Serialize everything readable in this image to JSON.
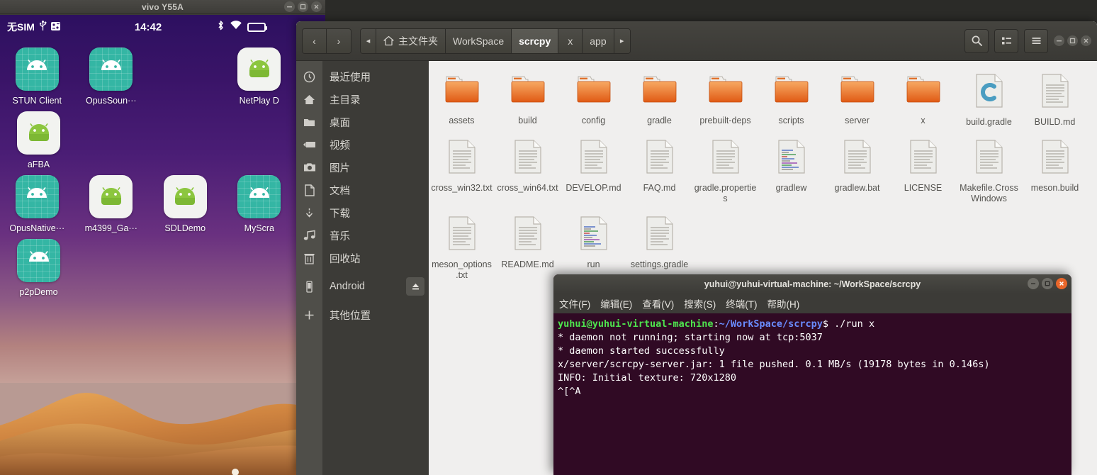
{
  "phone": {
    "window_title": "vivo Y55A",
    "window_controls": [
      "minimize",
      "maximize",
      "close"
    ],
    "status_bar": {
      "sim": "无SIM",
      "left_icons": [
        "usb-icon",
        "vpn-key-icon"
      ],
      "time": "14:42",
      "right_icons": [
        "bluetooth-icon",
        "wifi-icon",
        "battery-icon"
      ]
    },
    "apps": [
      {
        "label": "STUN Client",
        "icon": "android-robot-icon",
        "style": "teal"
      },
      {
        "label": "OpusSoun···",
        "icon": "android-robot-icon",
        "style": "teal"
      },
      {
        "label": "",
        "icon": "",
        "style": "empty"
      },
      {
        "label": "NetPlay D",
        "icon": "android-robot-icon",
        "style": "white"
      },
      {
        "label": "aFBA",
        "icon": "android-robot-icon",
        "style": "white"
      },
      {
        "label": "OpusNative···",
        "icon": "android-robot-icon",
        "style": "teal"
      },
      {
        "label": "m4399_Ga···",
        "icon": "android-robot-icon",
        "style": "white"
      },
      {
        "label": "SDLDemo",
        "icon": "android-robot-icon",
        "style": "white"
      },
      {
        "label": "MyScra",
        "icon": "android-robot-icon",
        "style": "teal"
      },
      {
        "label": "p2pDemo",
        "icon": "android-robot-icon",
        "style": "teal"
      }
    ]
  },
  "file_manager": {
    "nav": {
      "back": "‹",
      "forward": "›"
    },
    "breadcrumb_scroll_left": "◂",
    "breadcrumb_scroll_right": "▸",
    "breadcrumbs": [
      {
        "label": "主文件夹",
        "icon": "home-icon",
        "active": false
      },
      {
        "label": "WorkSpace",
        "icon": "",
        "active": false
      },
      {
        "label": "scrcpy",
        "icon": "",
        "active": true
      },
      {
        "label": "x",
        "icon": "",
        "active": false
      },
      {
        "label": "app",
        "icon": "",
        "active": false
      }
    ],
    "header_buttons": [
      "search-icon",
      "view-list-icon",
      "hamburger-menu-icon"
    ],
    "window_controls": [
      "minimize",
      "maximize",
      "close"
    ],
    "sidebar": [
      {
        "label": "最近使用",
        "icon": "clock-icon"
      },
      {
        "label": "主目录",
        "icon": "home-icon"
      },
      {
        "label": "桌面",
        "icon": "folder-icon"
      },
      {
        "label": "视频",
        "icon": "video-icon"
      },
      {
        "label": "图片",
        "icon": "camera-icon"
      },
      {
        "label": "文档",
        "icon": "document-icon"
      },
      {
        "label": "下载",
        "icon": "download-icon"
      },
      {
        "label": "音乐",
        "icon": "music-icon"
      },
      {
        "label": "回收站",
        "icon": "trash-icon"
      },
      {
        "label": "Android",
        "icon": "phone-icon",
        "eject": true
      },
      {
        "label": "其他位置",
        "icon": "plus-icon"
      }
    ],
    "files": [
      {
        "name": "assets",
        "type": "folder"
      },
      {
        "name": "build",
        "type": "folder"
      },
      {
        "name": "config",
        "type": "folder"
      },
      {
        "name": "gradle",
        "type": "folder"
      },
      {
        "name": "prebuilt-deps",
        "type": "folder"
      },
      {
        "name": "scripts",
        "type": "folder"
      },
      {
        "name": "server",
        "type": "folder"
      },
      {
        "name": "x",
        "type": "folder"
      },
      {
        "name": "build.gradle",
        "type": "gradle"
      },
      {
        "name": "BUILD.md",
        "type": "text"
      },
      {
        "name": "cross_win32.txt",
        "type": "text"
      },
      {
        "name": "cross_win64.txt",
        "type": "text"
      },
      {
        "name": "DEVELOP.md",
        "type": "text"
      },
      {
        "name": "FAQ.md",
        "type": "text"
      },
      {
        "name": "gradle.properties",
        "type": "text"
      },
      {
        "name": "gradlew",
        "type": "script"
      },
      {
        "name": "gradlew.bat",
        "type": "text"
      },
      {
        "name": "LICENSE",
        "type": "text"
      },
      {
        "name": "Makefile.CrossWindows",
        "type": "text"
      },
      {
        "name": "meson.build",
        "type": "text"
      },
      {
        "name": "meson_options.txt",
        "type": "text"
      },
      {
        "name": "README.md",
        "type": "text"
      },
      {
        "name": "run",
        "type": "script"
      },
      {
        "name": "settings.gradle",
        "type": "text"
      }
    ]
  },
  "terminal": {
    "title": "yuhui@yuhui-virtual-machine: ~/WorkSpace/scrcpy",
    "menu": [
      "文件(F)",
      "编辑(E)",
      "查看(V)",
      "搜索(S)",
      "终端(T)",
      "帮助(H)"
    ],
    "window_controls": [
      "minimize",
      "maximize",
      "close"
    ],
    "prompt_user": "yuhui@yuhui-virtual-machine",
    "prompt_sep": ":",
    "prompt_path": "~/WorkSpace/scrcpy",
    "prompt_dollar": "$",
    "command": " ./run x",
    "output_lines": [
      "* daemon not running; starting now at tcp:5037",
      "* daemon started successfully",
      "x/server/scrcpy-server.jar: 1 file pushed. 0.1 MB/s (19178 bytes in 0.146s)",
      "INFO: Initial texture: 720x1280",
      "^[^A"
    ]
  },
  "colors": {
    "terminal_bg": "#300a24",
    "chrome_dark": "#3c3b37",
    "folder_orange": "#e8762c",
    "accent_close": "#e8662a",
    "phone_screen_top": "#2d1060"
  }
}
